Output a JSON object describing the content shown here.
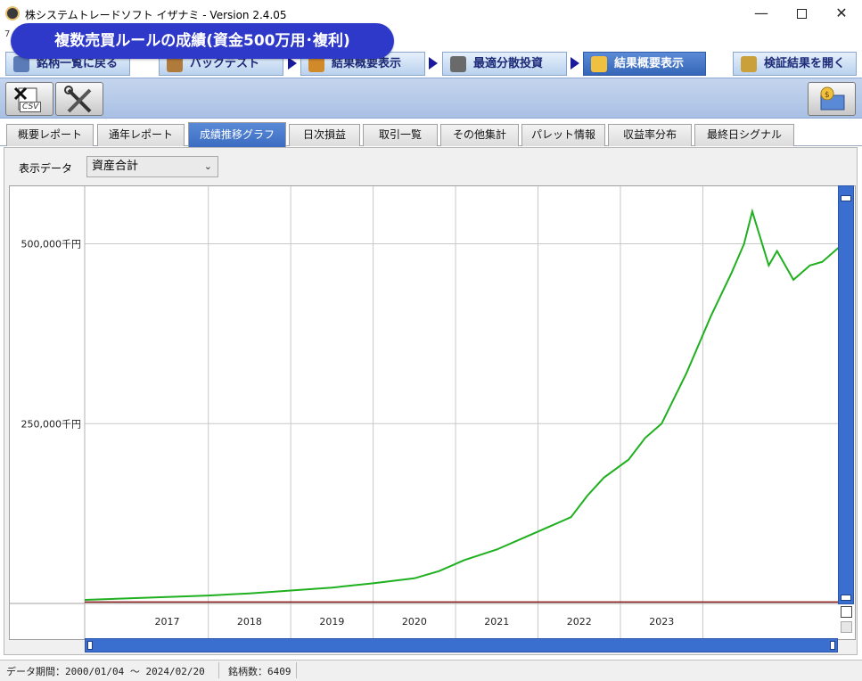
{
  "window": {
    "title": "株システムトレードソフト イザナミ - Version 2.4.05",
    "row_digit": "7"
  },
  "rule_badge": "複数売買ルールの成績(資金500万用･複利)",
  "nav": {
    "tabs": [
      "銘柄一覧に戻る",
      "バックテスト",
      "結果概要表示",
      "最適分散投資",
      "結果概要表示",
      "検証結果を開く"
    ],
    "active_index": 4
  },
  "toolbar": {
    "csv_label": "CSV"
  },
  "report_tabs": {
    "items": [
      "概要レポート",
      "通年レポート",
      "成績推移グラフ",
      "日次損益",
      "取引一覧",
      "その他集計",
      "パレット情報",
      "収益率分布",
      "最終日シグナル"
    ],
    "active_index": 2
  },
  "display_data": {
    "label": "表示データ",
    "selected": "資産合計"
  },
  "chart_data": {
    "type": "line",
    "xlabel": "",
    "ylabel": "",
    "x_ticks": [
      "2017",
      "2018",
      "2019",
      "2020",
      "2021",
      "2022",
      "2023"
    ],
    "y_ticks": [
      "250,000千円",
      "500,000千円"
    ],
    "ylim": [
      0,
      580000
    ],
    "grid": true,
    "series": [
      {
        "color": "#1fb01f",
        "x": [
          2016.0,
          2016.5,
          2017.0,
          2017.5,
          2018.0,
          2018.5,
          2019.0,
          2019.5,
          2020.0,
          2020.3,
          2020.6,
          2021.0,
          2021.3,
          2021.6,
          2021.9,
          2022.1,
          2022.3,
          2022.6,
          2022.8,
          2023.0,
          2023.3,
          2023.6,
          2023.85,
          2024.0,
          2024.1,
          2024.3,
          2024.4,
          2024.6,
          2024.8,
          2024.95,
          2025.15
        ],
        "values": [
          5000,
          7000,
          9000,
          11000,
          14000,
          18000,
          22000,
          28000,
          35000,
          45000,
          60000,
          75000,
          90000,
          105000,
          120000,
          150000,
          175000,
          200000,
          230000,
          250000,
          320000,
          400000,
          460000,
          500000,
          545000,
          470000,
          490000,
          450000,
          470000,
          475000,
          495000
        ]
      },
      {
        "color": "#8b1a1a",
        "x": [
          2016.0,
          2025.15
        ],
        "values": [
          2000,
          2000
        ]
      }
    ]
  },
  "status": {
    "period": "データ期間：2000/01/04 〜 2024/02/20",
    "count": "銘柄数：6409"
  },
  "colors": {
    "accent": "#2e39c9",
    "tab_active": "#3b6cc2",
    "line": "#1fb01f"
  }
}
